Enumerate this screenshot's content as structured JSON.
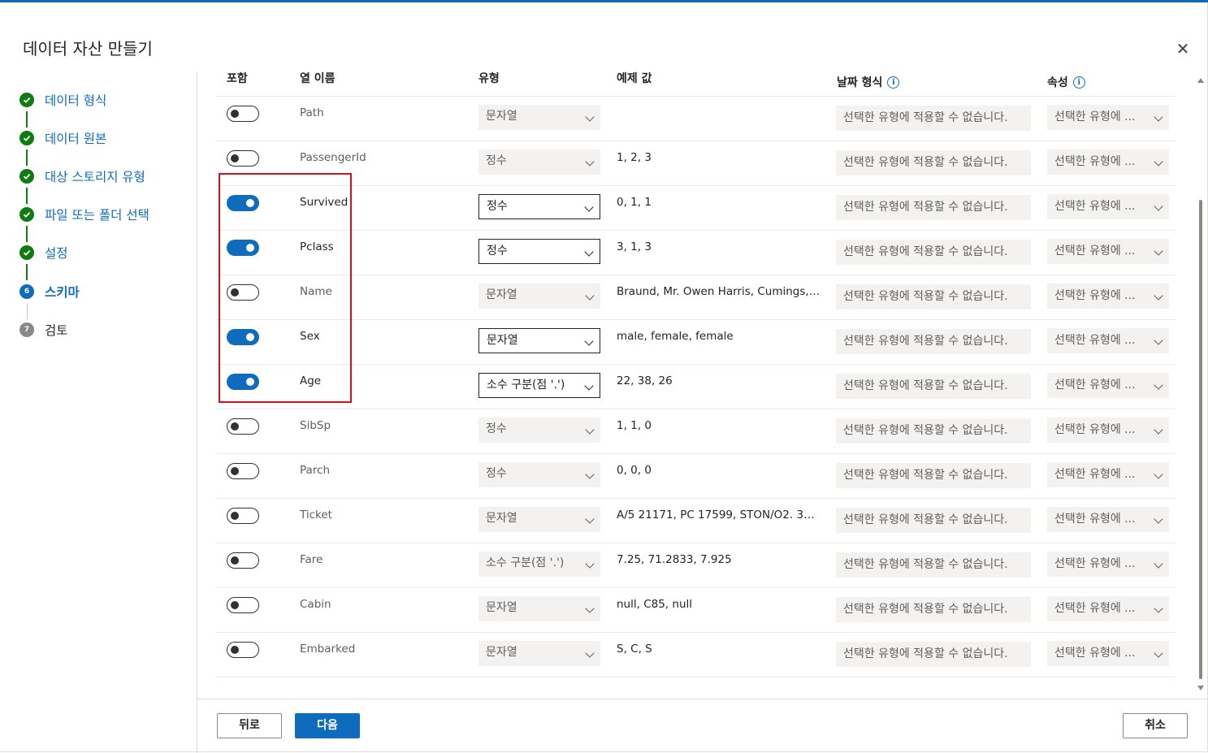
{
  "dialog": {
    "title": "데이터 자산 만들기",
    "close_glyph": "✕"
  },
  "steps": [
    {
      "label": "데이터 형식",
      "state": "done"
    },
    {
      "label": "데이터 원본",
      "state": "done"
    },
    {
      "label": "대상 스토리지 유형",
      "state": "done"
    },
    {
      "label": "파일 또는 폴더 선택",
      "state": "done"
    },
    {
      "label": "설정",
      "state": "done"
    },
    {
      "label": "스키마",
      "state": "current",
      "number": "6"
    },
    {
      "label": "검토",
      "state": "todo",
      "number": "7"
    }
  ],
  "headers": {
    "include": "포함",
    "column_name": "열 이름",
    "type": "유형",
    "sample": "예제 값",
    "date_format": "날짜 형식",
    "properties": "속성",
    "info_glyph": "i"
  },
  "rows": [
    {
      "name": "Path",
      "include": false,
      "type": "문자열",
      "sample": "",
      "date_format": "선택한 유형에 적용할 수 없습니다.",
      "property": "선택한 유형에 ..."
    },
    {
      "name": "PassengerId",
      "include": false,
      "type": "정수",
      "sample": "1, 2, 3",
      "date_format": "선택한 유형에 적용할 수 없습니다.",
      "property": "선택한 유형에 ..."
    },
    {
      "name": "Survived",
      "include": true,
      "type": "정수",
      "sample": "0, 1, 1",
      "date_format": "선택한 유형에 적용할 수 없습니다.",
      "property": "선택한 유형에 ..."
    },
    {
      "name": "Pclass",
      "include": true,
      "type": "정수",
      "sample": "3, 1, 3",
      "date_format": "선택한 유형에 적용할 수 없습니다.",
      "property": "선택한 유형에 ..."
    },
    {
      "name": "Name",
      "include": false,
      "type": "문자열",
      "sample": "Braund, Mr. Owen Harris, Cumings, Mr...",
      "date_format": "선택한 유형에 적용할 수 없습니다.",
      "property": "선택한 유형에 ..."
    },
    {
      "name": "Sex",
      "include": true,
      "type": "문자열",
      "sample": "male, female, female",
      "date_format": "선택한 유형에 적용할 수 없습니다.",
      "property": "선택한 유형에 ..."
    },
    {
      "name": "Age",
      "include": true,
      "type": "소수 구분(점 '.')",
      "sample": "22, 38, 26",
      "date_format": "선택한 유형에 적용할 수 없습니다.",
      "property": "선택한 유형에 ..."
    },
    {
      "name": "SibSp",
      "include": false,
      "type": "정수",
      "sample": "1, 1, 0",
      "date_format": "선택한 유형에 적용할 수 없습니다.",
      "property": "선택한 유형에 ..."
    },
    {
      "name": "Parch",
      "include": false,
      "type": "정수",
      "sample": "0, 0, 0",
      "date_format": "선택한 유형에 적용할 수 없습니다.",
      "property": "선택한 유형에 ..."
    },
    {
      "name": "Ticket",
      "include": false,
      "type": "문자열",
      "sample": "A/5 21171, PC 17599, STON/O2. 31012...",
      "date_format": "선택한 유형에 적용할 수 없습니다.",
      "property": "선택한 유형에 ..."
    },
    {
      "name": "Fare",
      "include": false,
      "type": "소수 구분(점 '.')",
      "sample": "7.25, 71.2833, 7.925",
      "date_format": "선택한 유형에 적용할 수 없습니다.",
      "property": "선택한 유형에 ..."
    },
    {
      "name": "Cabin",
      "include": false,
      "type": "문자열",
      "sample": "null, C85, null",
      "date_format": "선택한 유형에 적용할 수 없습니다.",
      "property": "선택한 유형에 ..."
    },
    {
      "name": "Embarked",
      "include": false,
      "type": "문자열",
      "sample": "S, C, S",
      "date_format": "선택한 유형에 적용할 수 없습니다.",
      "property": "선택한 유형에 ..."
    }
  ],
  "footer": {
    "back": "뒤로",
    "next": "다음",
    "cancel": "취소"
  },
  "colors": {
    "accent": "#0f6cbd",
    "done": "#107c10",
    "highlight": "#e00b1c"
  }
}
